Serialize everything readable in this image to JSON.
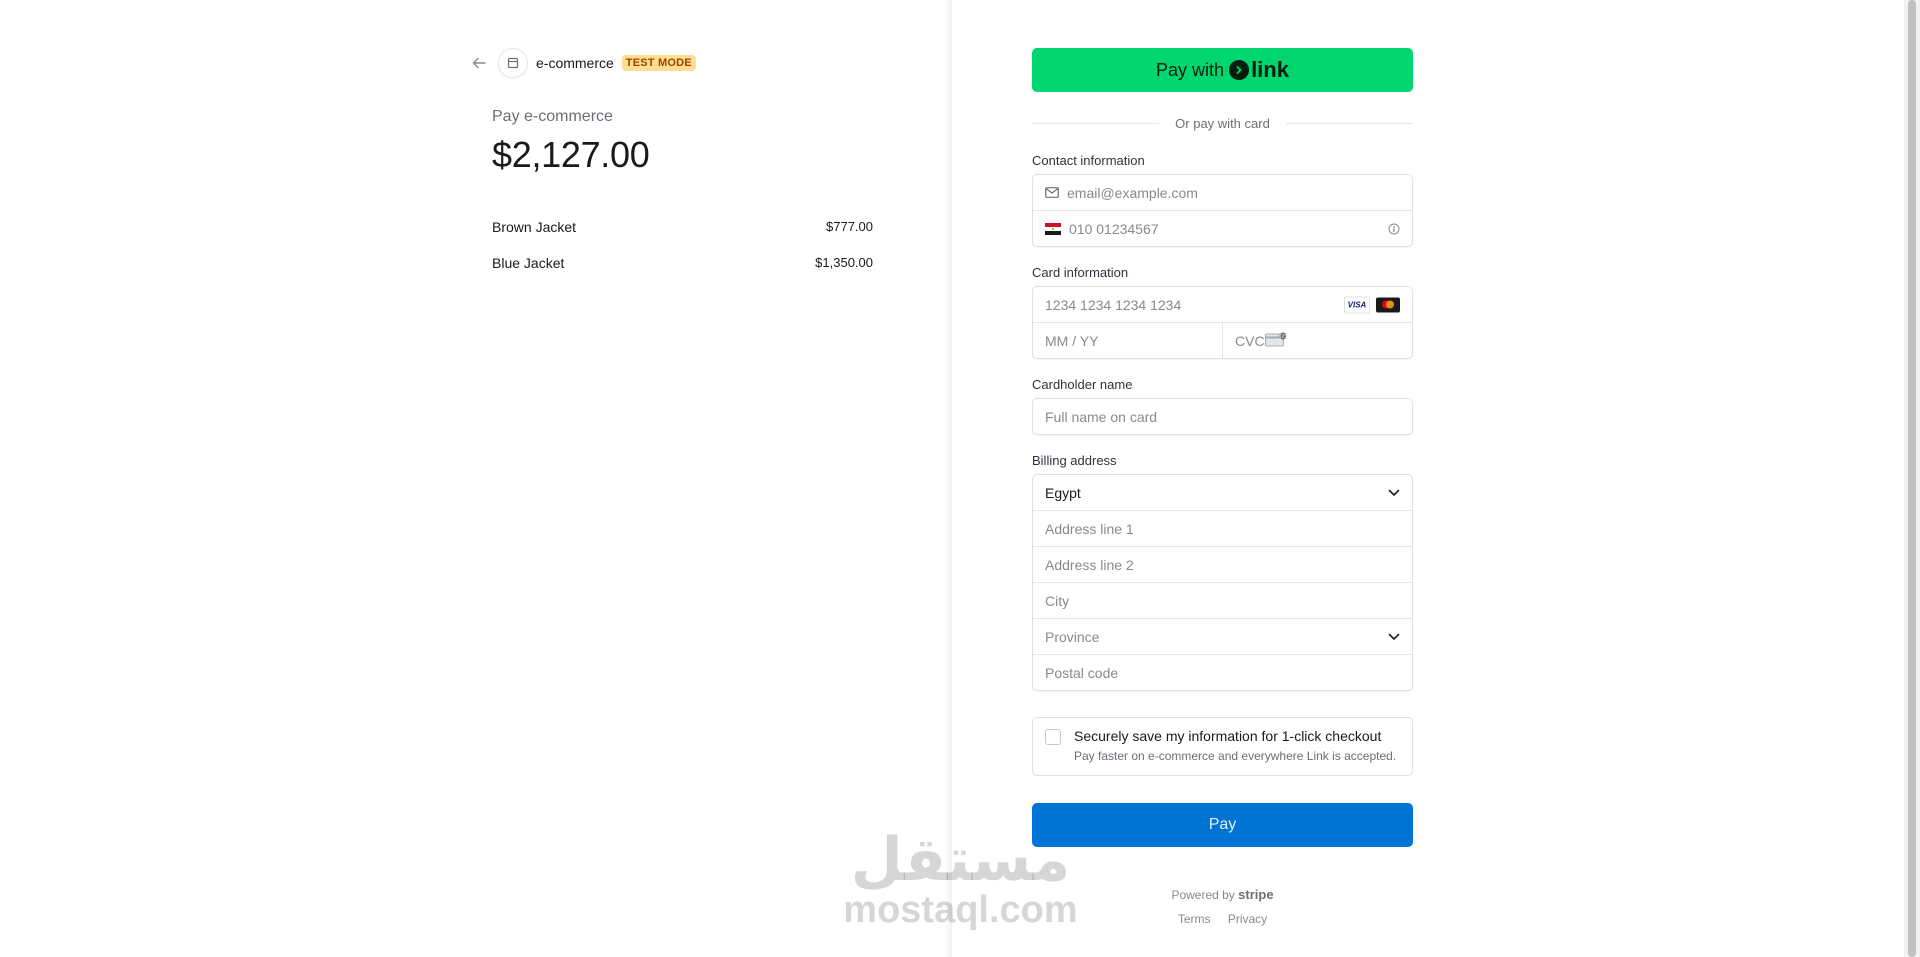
{
  "merchant": {
    "name": "e-commerce",
    "badge": "TEST MODE"
  },
  "summary": {
    "pay_label": "Pay e-commerce",
    "amount": "$2,127.00",
    "items": [
      {
        "name": "Brown Jacket",
        "price": "$777.00"
      },
      {
        "name": "Blue Jacket",
        "price": "$1,350.00"
      }
    ]
  },
  "link_button": {
    "prefix": "Pay with",
    "brand": "link"
  },
  "divider_text": "Or pay with card",
  "contact": {
    "label": "Contact information",
    "email_placeholder": "email@example.com",
    "phone_placeholder": "010 01234567"
  },
  "card": {
    "label": "Card information",
    "number_placeholder": "1234 1234 1234 1234",
    "expiry_placeholder": "MM / YY",
    "cvc_placeholder": "CVC",
    "brands": [
      "VISA",
      "mastercard"
    ]
  },
  "cardholder": {
    "label": "Cardholder name",
    "placeholder": "Full name on card"
  },
  "billing": {
    "label": "Billing address",
    "country": "Egypt",
    "address1_placeholder": "Address line 1",
    "address2_placeholder": "Address line 2",
    "city_placeholder": "City",
    "province_placeholder": "Province",
    "postal_placeholder": "Postal code"
  },
  "save_info": {
    "title": "Securely save my information for 1-click checkout",
    "description": "Pay faster on e-commerce and everywhere Link is accepted."
  },
  "pay_button": "Pay",
  "footer": {
    "powered_by": "Powered by",
    "brand": "stripe",
    "terms": "Terms",
    "privacy": "Privacy"
  },
  "watermark": {
    "arabic": "مستقل",
    "latin": "mostaql.com"
  },
  "colors": {
    "link_green": "#00d66f",
    "pay_blue": "#0074d4",
    "test_badge_bg": "#ffde92",
    "test_badge_text": "#a04100"
  }
}
